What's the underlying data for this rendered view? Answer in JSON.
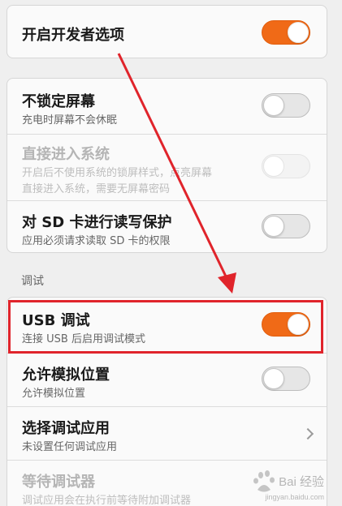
{
  "dev_options": {
    "title": "开启开发者选项",
    "enabled": true
  },
  "display_group": {
    "items": [
      {
        "title": "不锁定屏幕",
        "subtitle": "充电时屏幕不会休眠",
        "state": "off",
        "disabled": false
      },
      {
        "title": "直接进入系统",
        "subtitle": "开启后不使用系统的锁屏样式，点亮屏幕",
        "subtitle2": "直接进入系统，需要无屏幕密码",
        "state": "off",
        "disabled": true
      },
      {
        "title": "对 SD 卡进行读写保护",
        "subtitle": "应用必须请求读取 SD 卡的权限",
        "state": "off",
        "disabled": false
      }
    ]
  },
  "debug_section": {
    "label": "调试",
    "items": [
      {
        "title": "USB 调试",
        "subtitle": "连接 USB 后启用调试模式",
        "state": "on"
      },
      {
        "title": "允许模拟位置",
        "subtitle": "允许模拟位置",
        "state": "off"
      },
      {
        "title": "选择调试应用",
        "subtitle": "未设置任何调试应用",
        "control": "chevron"
      },
      {
        "title": "等待调试器",
        "subtitle": "调试应用会在执行前等待附加调试器",
        "disabled": true
      }
    ]
  },
  "annotation_color": "#e0242b",
  "accent_color": "#f06a17",
  "watermark": {
    "text": "Bai 经验",
    "url_text": "jingyan.baidu.com"
  }
}
